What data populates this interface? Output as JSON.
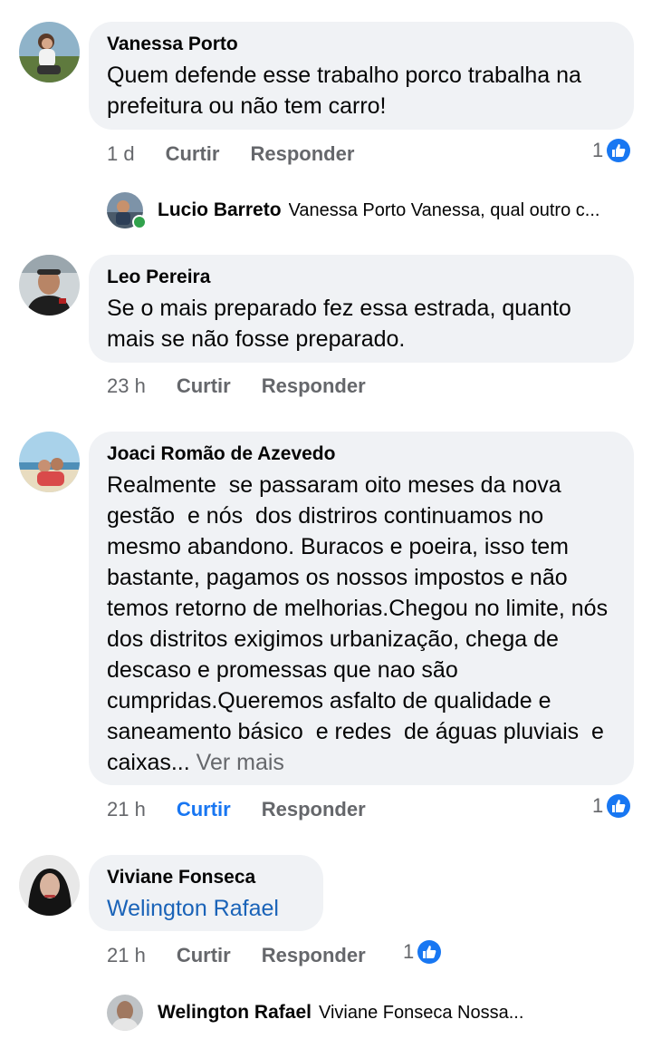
{
  "comments": [
    {
      "author": "Vanessa Porto",
      "text": "Quem defende esse trabalho porco trabalha na prefeitura ou não tem carro!",
      "time": "1 d",
      "like_label": "Curtir",
      "reply_label": "Responder",
      "reaction_count": "1",
      "reply": {
        "author": "Lucio Barreto",
        "preview": "Vanessa Porto Vanessa, qual outro c..."
      }
    },
    {
      "author": "Leo Pereira",
      "text": "Se o mais preparado fez essa estrada, quanto mais se não fosse preparado.",
      "time": "23 h",
      "like_label": "Curtir",
      "reply_label": "Responder"
    },
    {
      "author": "Joaci Romão de Azevedo",
      "text": "Realmente  se passaram oito meses da nova gestão  e nós  dos distriros continuamos no mesmo abandono. Buracos e poeira, isso tem bastante, pagamos os nossos impostos e não temos retorno de melhorias.Chegou no limite, nós  dos distritos exigimos urbanização, chega de descaso e promessas que nao são cumpridas.Queremos asfalto de qualidade e saneamento básico  e redes  de águas pluviais  e caixas...",
      "see_more": "Ver mais",
      "time": "21 h",
      "like_label": "Curtir",
      "reply_label": "Responder",
      "reaction_count": "1"
    },
    {
      "author": "Viviane Fonseca",
      "mention": "Welington Rafael",
      "time": "21 h",
      "like_label": "Curtir",
      "reply_label": "Responder",
      "reaction_count": "1",
      "reply": {
        "author": "Welington Rafael",
        "preview": "Viviane Fonseca Nossa..."
      }
    }
  ],
  "colors": {
    "bubble": "#f0f2f5",
    "like_blue": "#1877f2",
    "mention": "#1a63b8",
    "meta": "#65676b"
  }
}
